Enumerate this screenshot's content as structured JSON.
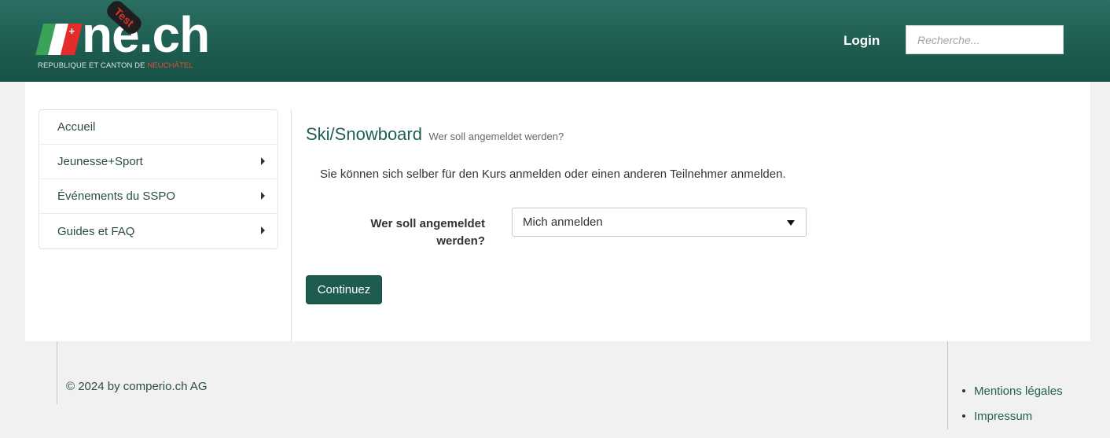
{
  "header": {
    "logo_text": "ne.ch",
    "logo_badge": "Test",
    "logo_subtitle_prefix": "REPUBLIQUE ET CANTON DE ",
    "logo_subtitle_accent": "NEUCHÂTEL",
    "login_label": "Login",
    "search_placeholder": "Recherche..."
  },
  "sidebar": {
    "items": [
      {
        "label": "Accueil",
        "has_submenu": false
      },
      {
        "label": "Jeunesse+Sport",
        "has_submenu": true
      },
      {
        "label": "Événements du SSPO",
        "has_submenu": true
      },
      {
        "label": "Guides et FAQ",
        "has_submenu": true
      }
    ]
  },
  "main": {
    "title": "Ski/Snowboard",
    "subtitle": "Wer soll angemeldet werden?",
    "intro": "Sie können sich selber für den Kurs anmelden oder einen anderen Teilnehmer anmelden.",
    "field_label_line1": "Wer soll angemeldet",
    "field_label_line2": "werden?",
    "select_value": "Mich anmelden",
    "continue_label": "Continuez"
  },
  "footer": {
    "copyright": "© 2024 by comperio.ch AG",
    "links": [
      "Mentions légales",
      "Impressum"
    ]
  },
  "colors": {
    "brand_green": "#1e5c50",
    "accent_red": "#e0302d"
  }
}
